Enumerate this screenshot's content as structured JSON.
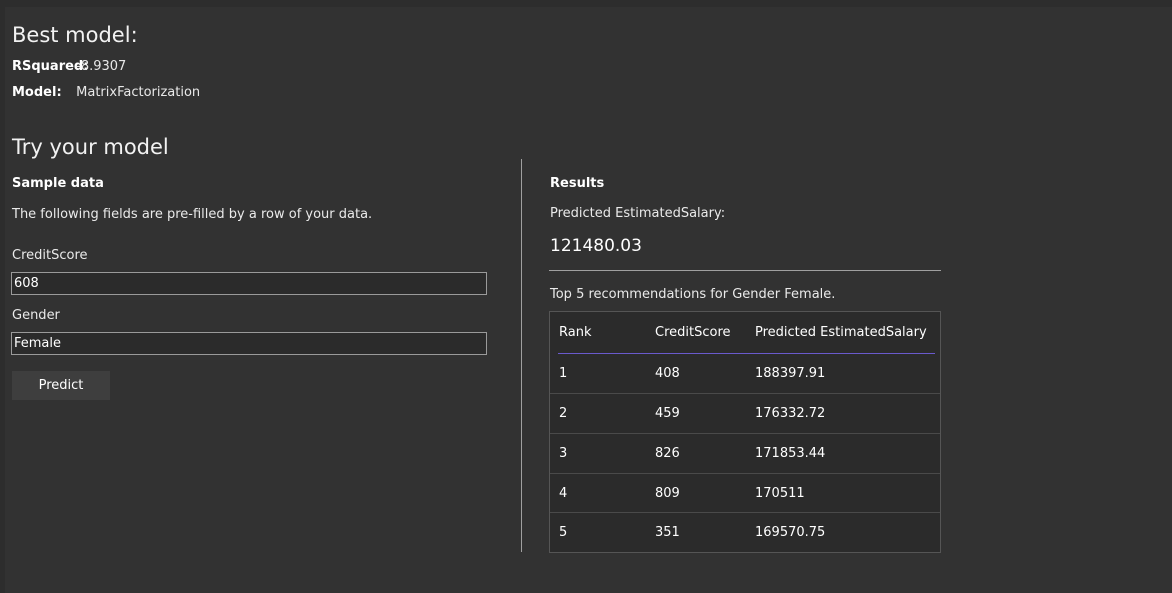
{
  "best_model": {
    "title": "Best model:",
    "metrics": [
      {
        "label": "RSquared:",
        "value": "-8.9307"
      },
      {
        "label": "Model:",
        "value": "MatrixFactorization"
      }
    ]
  },
  "try_model": {
    "title": "Try your model",
    "sample": {
      "heading": "Sample data",
      "description": "The following fields are pre-filled by a row of your data.",
      "fields": [
        {
          "label": "CreditScore",
          "value": "608"
        },
        {
          "label": "Gender",
          "value": "Female"
        }
      ],
      "predict_label": "Predict"
    },
    "results": {
      "heading": "Results",
      "prediction_label": "Predicted EstimatedSalary:",
      "prediction_value": "121480.03",
      "recommendations_caption": "Top 5 recommendations for Gender Female.",
      "columns": [
        "Rank",
        "CreditScore",
        "Predicted EstimatedSalary"
      ],
      "rows": [
        [
          "1",
          "408",
          "188397.91"
        ],
        [
          "2",
          "459",
          "176332.72"
        ],
        [
          "3",
          "826",
          "171853.44"
        ],
        [
          "4",
          "809",
          "170511"
        ],
        [
          "5",
          "351",
          "169570.75"
        ]
      ]
    }
  }
}
